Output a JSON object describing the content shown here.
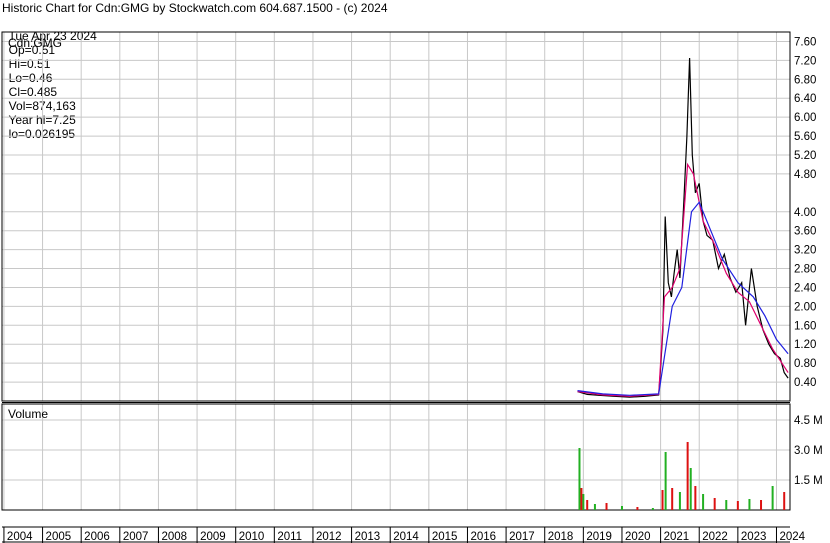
{
  "header": {
    "title": "Historic Chart for Cdn:GMG by Stockwatch.com 604.687.1500 - (c) 2024",
    "date": "Tue Apr 23 2024",
    "open": "Op=0.51",
    "high": "Hi=0.51",
    "low": "Lo=0.46",
    "close": "Cl=0.485",
    "volume": "Vol=874,163",
    "year_high": "Year hi=7.25",
    "year_low": "lo=0.026195"
  },
  "colors": {
    "price": "#000000",
    "ma_short": "#e0006e",
    "ma_long": "#2020e0",
    "vol_up": "#22b022",
    "vol_down": "#dd1111",
    "grid": "#c8c8c8"
  },
  "chart_data": [
    {
      "type": "line",
      "label": "Cdn:GMG",
      "ylim": [
        0,
        7.8
      ],
      "y_ticks": [
        "7.60",
        "7.20",
        "6.80",
        "6.40",
        "6.00",
        "5.60",
        "5.20",
        "4.80",
        "4.00",
        "3.60",
        "3.20",
        "2.80",
        "2.40",
        "2.00",
        "1.60",
        "1.20",
        "0.80",
        "0.40"
      ],
      "x_ticks": [
        "2004",
        "2005",
        "2006",
        "2007",
        "2008",
        "2009",
        "2010",
        "2011",
        "2012",
        "2013",
        "2014",
        "2015",
        "2016",
        "2017",
        "2018",
        "2019",
        "2020",
        "2021",
        "2022",
        "2023",
        "2024"
      ],
      "series": [
        {
          "values": [
            [
              2018.85,
              0.2
            ],
            [
              2019.1,
              0.14
            ],
            [
              2019.4,
              0.12
            ],
            [
              2019.8,
              0.1
            ],
            [
              2020.2,
              0.08
            ],
            [
              2020.6,
              0.1
            ],
            [
              2020.95,
              0.13
            ],
            [
              2021.0,
              0.7
            ],
            [
              2021.06,
              1.5
            ],
            [
              2021.12,
              3.9
            ],
            [
              2021.2,
              2.5
            ],
            [
              2021.28,
              2.2
            ],
            [
              2021.35,
              2.7
            ],
            [
              2021.43,
              3.2
            ],
            [
              2021.5,
              2.6
            ],
            [
              2021.6,
              4.2
            ],
            [
              2021.68,
              5.6
            ],
            [
              2021.75,
              7.25
            ],
            [
              2021.82,
              5.2
            ],
            [
              2021.9,
              4.4
            ],
            [
              2022.0,
              4.6
            ],
            [
              2022.1,
              3.8
            ],
            [
              2022.2,
              3.5
            ],
            [
              2022.35,
              3.4
            ],
            [
              2022.5,
              2.8
            ],
            [
              2022.65,
              3.1
            ],
            [
              2022.8,
              2.6
            ],
            [
              2022.95,
              2.3
            ],
            [
              2023.1,
              2.5
            ],
            [
              2023.2,
              1.6
            ],
            [
              2023.35,
              2.8
            ],
            [
              2023.5,
              2.0
            ],
            [
              2023.65,
              1.5
            ],
            [
              2023.8,
              1.2
            ],
            [
              2023.95,
              1.0
            ],
            [
              2024.1,
              0.9
            ],
            [
              2024.2,
              0.6
            ],
            [
              2024.3,
              0.485
            ]
          ]
        },
        {
          "values": [
            [
              2018.85,
              0.2
            ],
            [
              2019.5,
              0.13
            ],
            [
              2020.2,
              0.1
            ],
            [
              2020.95,
              0.14
            ],
            [
              2021.1,
              2.2
            ],
            [
              2021.3,
              2.4
            ],
            [
              2021.5,
              2.8
            ],
            [
              2021.7,
              5.0
            ],
            [
              2021.85,
              4.8
            ],
            [
              2022.1,
              3.8
            ],
            [
              2022.4,
              3.3
            ],
            [
              2022.7,
              2.7
            ],
            [
              2023.0,
              2.3
            ],
            [
              2023.3,
              2.1
            ],
            [
              2023.6,
              1.6
            ],
            [
              2023.9,
              1.1
            ],
            [
              2024.3,
              0.6
            ]
          ]
        },
        {
          "values": [
            [
              2018.85,
              0.22
            ],
            [
              2019.5,
              0.15
            ],
            [
              2020.2,
              0.12
            ],
            [
              2020.95,
              0.15
            ],
            [
              2021.3,
              2.0
            ],
            [
              2021.55,
              2.4
            ],
            [
              2021.8,
              4.0
            ],
            [
              2022.0,
              4.2
            ],
            [
              2022.3,
              3.6
            ],
            [
              2022.6,
              3.0
            ],
            [
              2023.0,
              2.5
            ],
            [
              2023.4,
              2.2
            ],
            [
              2023.7,
              1.8
            ],
            [
              2024.0,
              1.3
            ],
            [
              2024.3,
              1.0
            ]
          ]
        }
      ]
    },
    {
      "type": "bar",
      "label": "Volume",
      "ylim": [
        0,
        5.3
      ],
      "y_ticks": [
        "4.5 M",
        "3.0 M",
        "1.5 M"
      ],
      "values": [
        [
          2018.9,
          3.1
        ],
        [
          2018.95,
          1.1
        ],
        [
          2019.0,
          0.8
        ],
        [
          2019.1,
          0.5
        ],
        [
          2019.3,
          0.3
        ],
        [
          2019.6,
          0.35
        ],
        [
          2020.0,
          0.2
        ],
        [
          2020.4,
          0.15
        ],
        [
          2020.8,
          0.1
        ],
        [
          2021.05,
          1.0
        ],
        [
          2021.13,
          2.9
        ],
        [
          2021.3,
          1.1
        ],
        [
          2021.5,
          0.9
        ],
        [
          2021.7,
          3.4
        ],
        [
          2021.78,
          2.1
        ],
        [
          2021.9,
          1.2
        ],
        [
          2022.1,
          0.8
        ],
        [
          2022.4,
          0.6
        ],
        [
          2022.7,
          0.5
        ],
        [
          2023.0,
          0.45
        ],
        [
          2023.3,
          0.55
        ],
        [
          2023.6,
          0.5
        ],
        [
          2023.9,
          1.2
        ],
        [
          2024.2,
          0.9
        ]
      ]
    }
  ]
}
